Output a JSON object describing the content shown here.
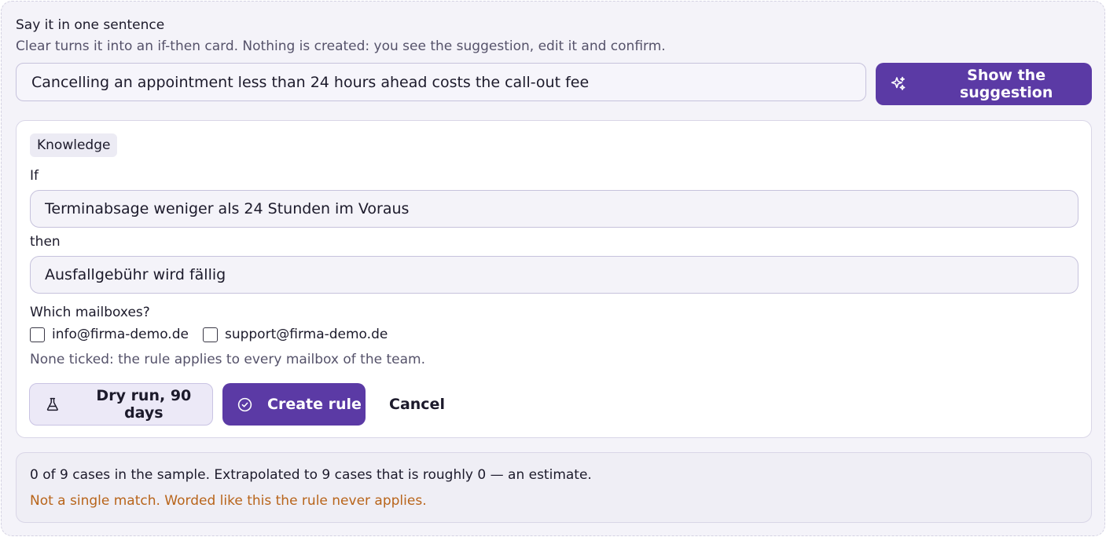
{
  "composer": {
    "title": "Say it in one sentence",
    "subtitle": "Clear turns it into an if-then card. Nothing is created: you see the suggestion, edit it and confirm.",
    "sentence_value": "Cancelling an appointment less than 24 hours ahead costs the call-out fee",
    "suggest_label": "Show the suggestion",
    "suggest_icon": "sparkle-icon"
  },
  "card": {
    "tag": "Knowledge",
    "if_label": "If",
    "if_value": "Terminabsage weniger als 24 Stunden im Voraus",
    "then_label": "then",
    "then_value": "Ausfallgebühr wird fällig",
    "mailboxes_label": "Which mailboxes?",
    "mailboxes": [
      {
        "label": "info@firma-demo.de",
        "checked": false
      },
      {
        "label": "support@firma-demo.de",
        "checked": false
      }
    ],
    "mailboxes_hint": "None ticked: the rule applies to every mailbox of the team.",
    "dry_run_label": "Dry run, 90 days",
    "dry_run_icon": "flask-icon",
    "create_label": "Create rule",
    "create_icon": "check-circle-icon",
    "cancel_label": "Cancel"
  },
  "result": {
    "summary": "0 of 9 cases in the sample. Extrapolated to 9 cases that is roughly 0 — an estimate.",
    "warning": "Not a single match. Worded like this the rule never applies."
  },
  "colors": {
    "accent": "#5b3aa5",
    "warning": "#b8641a"
  }
}
